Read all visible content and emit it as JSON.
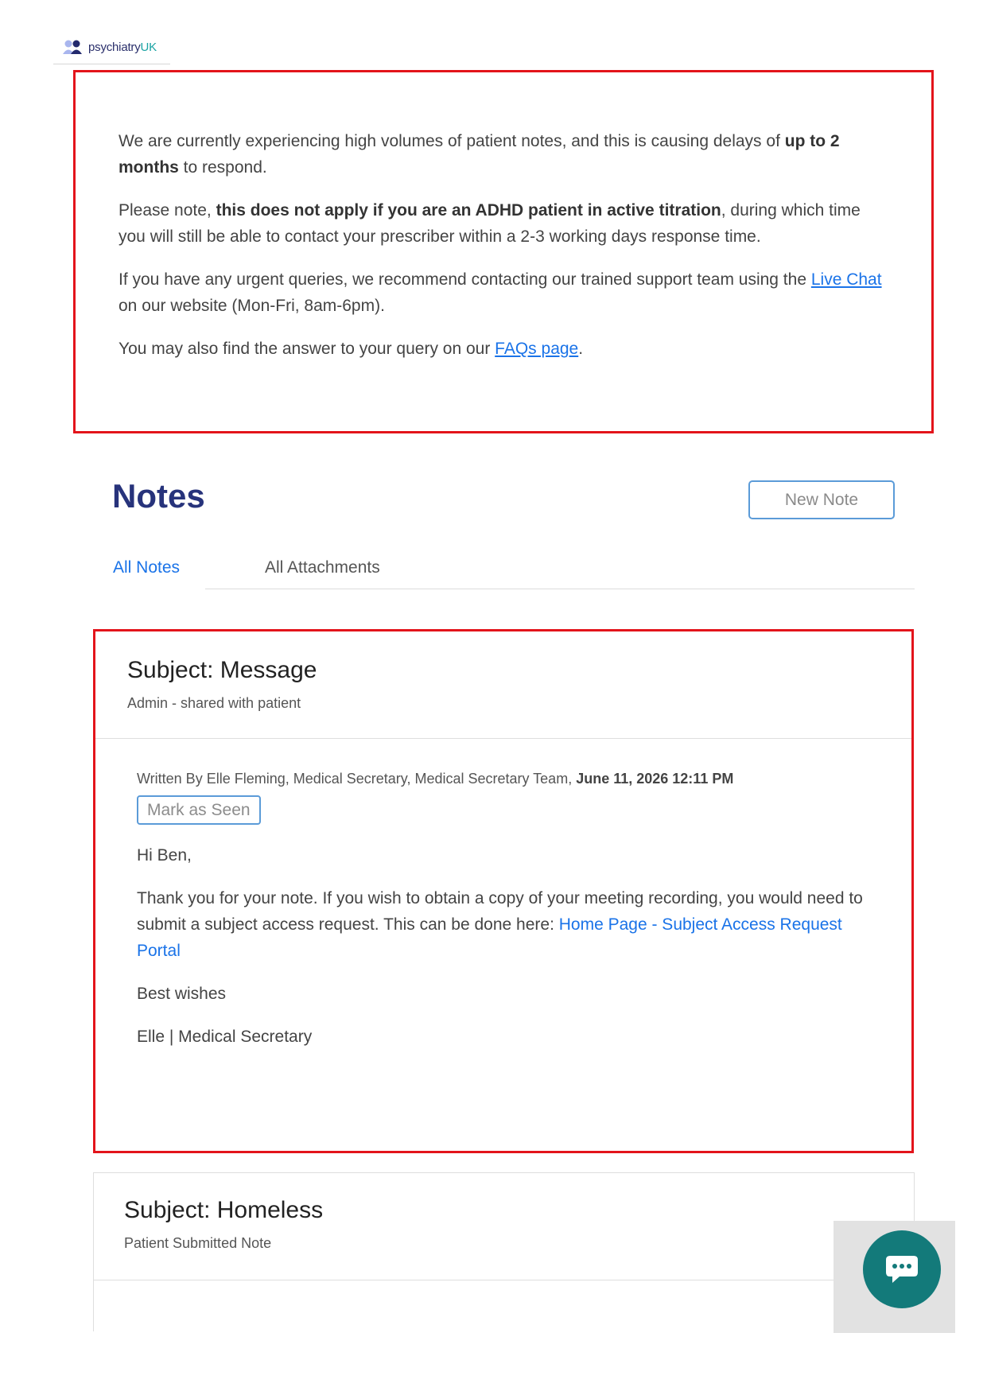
{
  "brand": {
    "name_main": "psychiatry",
    "name_suffix": "UK"
  },
  "notice": {
    "p1_a": "We are currently experiencing high volumes of patient notes, and this is causing delays of ",
    "p1_bold": "up to 2 months",
    "p1_b": " to respond.",
    "p2_a": "Please note, ",
    "p2_bold": "this does not apply if you are an ADHD patient in active titration",
    "p2_b": ", during which time you will still be able to contact your prescriber within a 2-3 working days response time.",
    "p3_a": "If you have any urgent queries, we recommend contacting our trained support team using the ",
    "p3_link": "Live Chat",
    "p3_b": " on our website (Mon-Fri, 8am-6pm).",
    "p4_a": "You may also find the answer to your query on our ",
    "p4_link": "FAQs page",
    "p4_b": "."
  },
  "page": {
    "title": "Notes",
    "new_note_label": "New Note"
  },
  "tabs": [
    {
      "label": "All Notes",
      "active": true
    },
    {
      "label": "All Attachments",
      "active": false
    }
  ],
  "notes": [
    {
      "subject": "Subject: Message",
      "meta": "Admin - shared with patient",
      "written_by": "Written By Elle Fleming, Medical Secretary, Medical Secretary Team, ",
      "date": "June 11, 2026 12:11 PM",
      "seen_label": "Mark as Seen",
      "greeting": "Hi Ben,",
      "body_a": "Thank you for your note. If you wish to obtain a copy of your meeting recording, you would need to submit a subject access request. This can be done here: ",
      "body_link": "Home Page - Subject Access Request Portal",
      "sign_off": "Best wishes",
      "signature": "Elle | Medical Secretary"
    },
    {
      "subject": "Subject: Homeless",
      "meta": "Patient Submitted Note"
    }
  ],
  "colors": {
    "brand_navy": "#27337b",
    "link_blue": "#1a73e8",
    "highlight_red": "#e3141b",
    "chat_teal": "#137a7a"
  },
  "icons": {
    "logo": "people-logo-icon",
    "chat": "chat-bubble-icon"
  }
}
